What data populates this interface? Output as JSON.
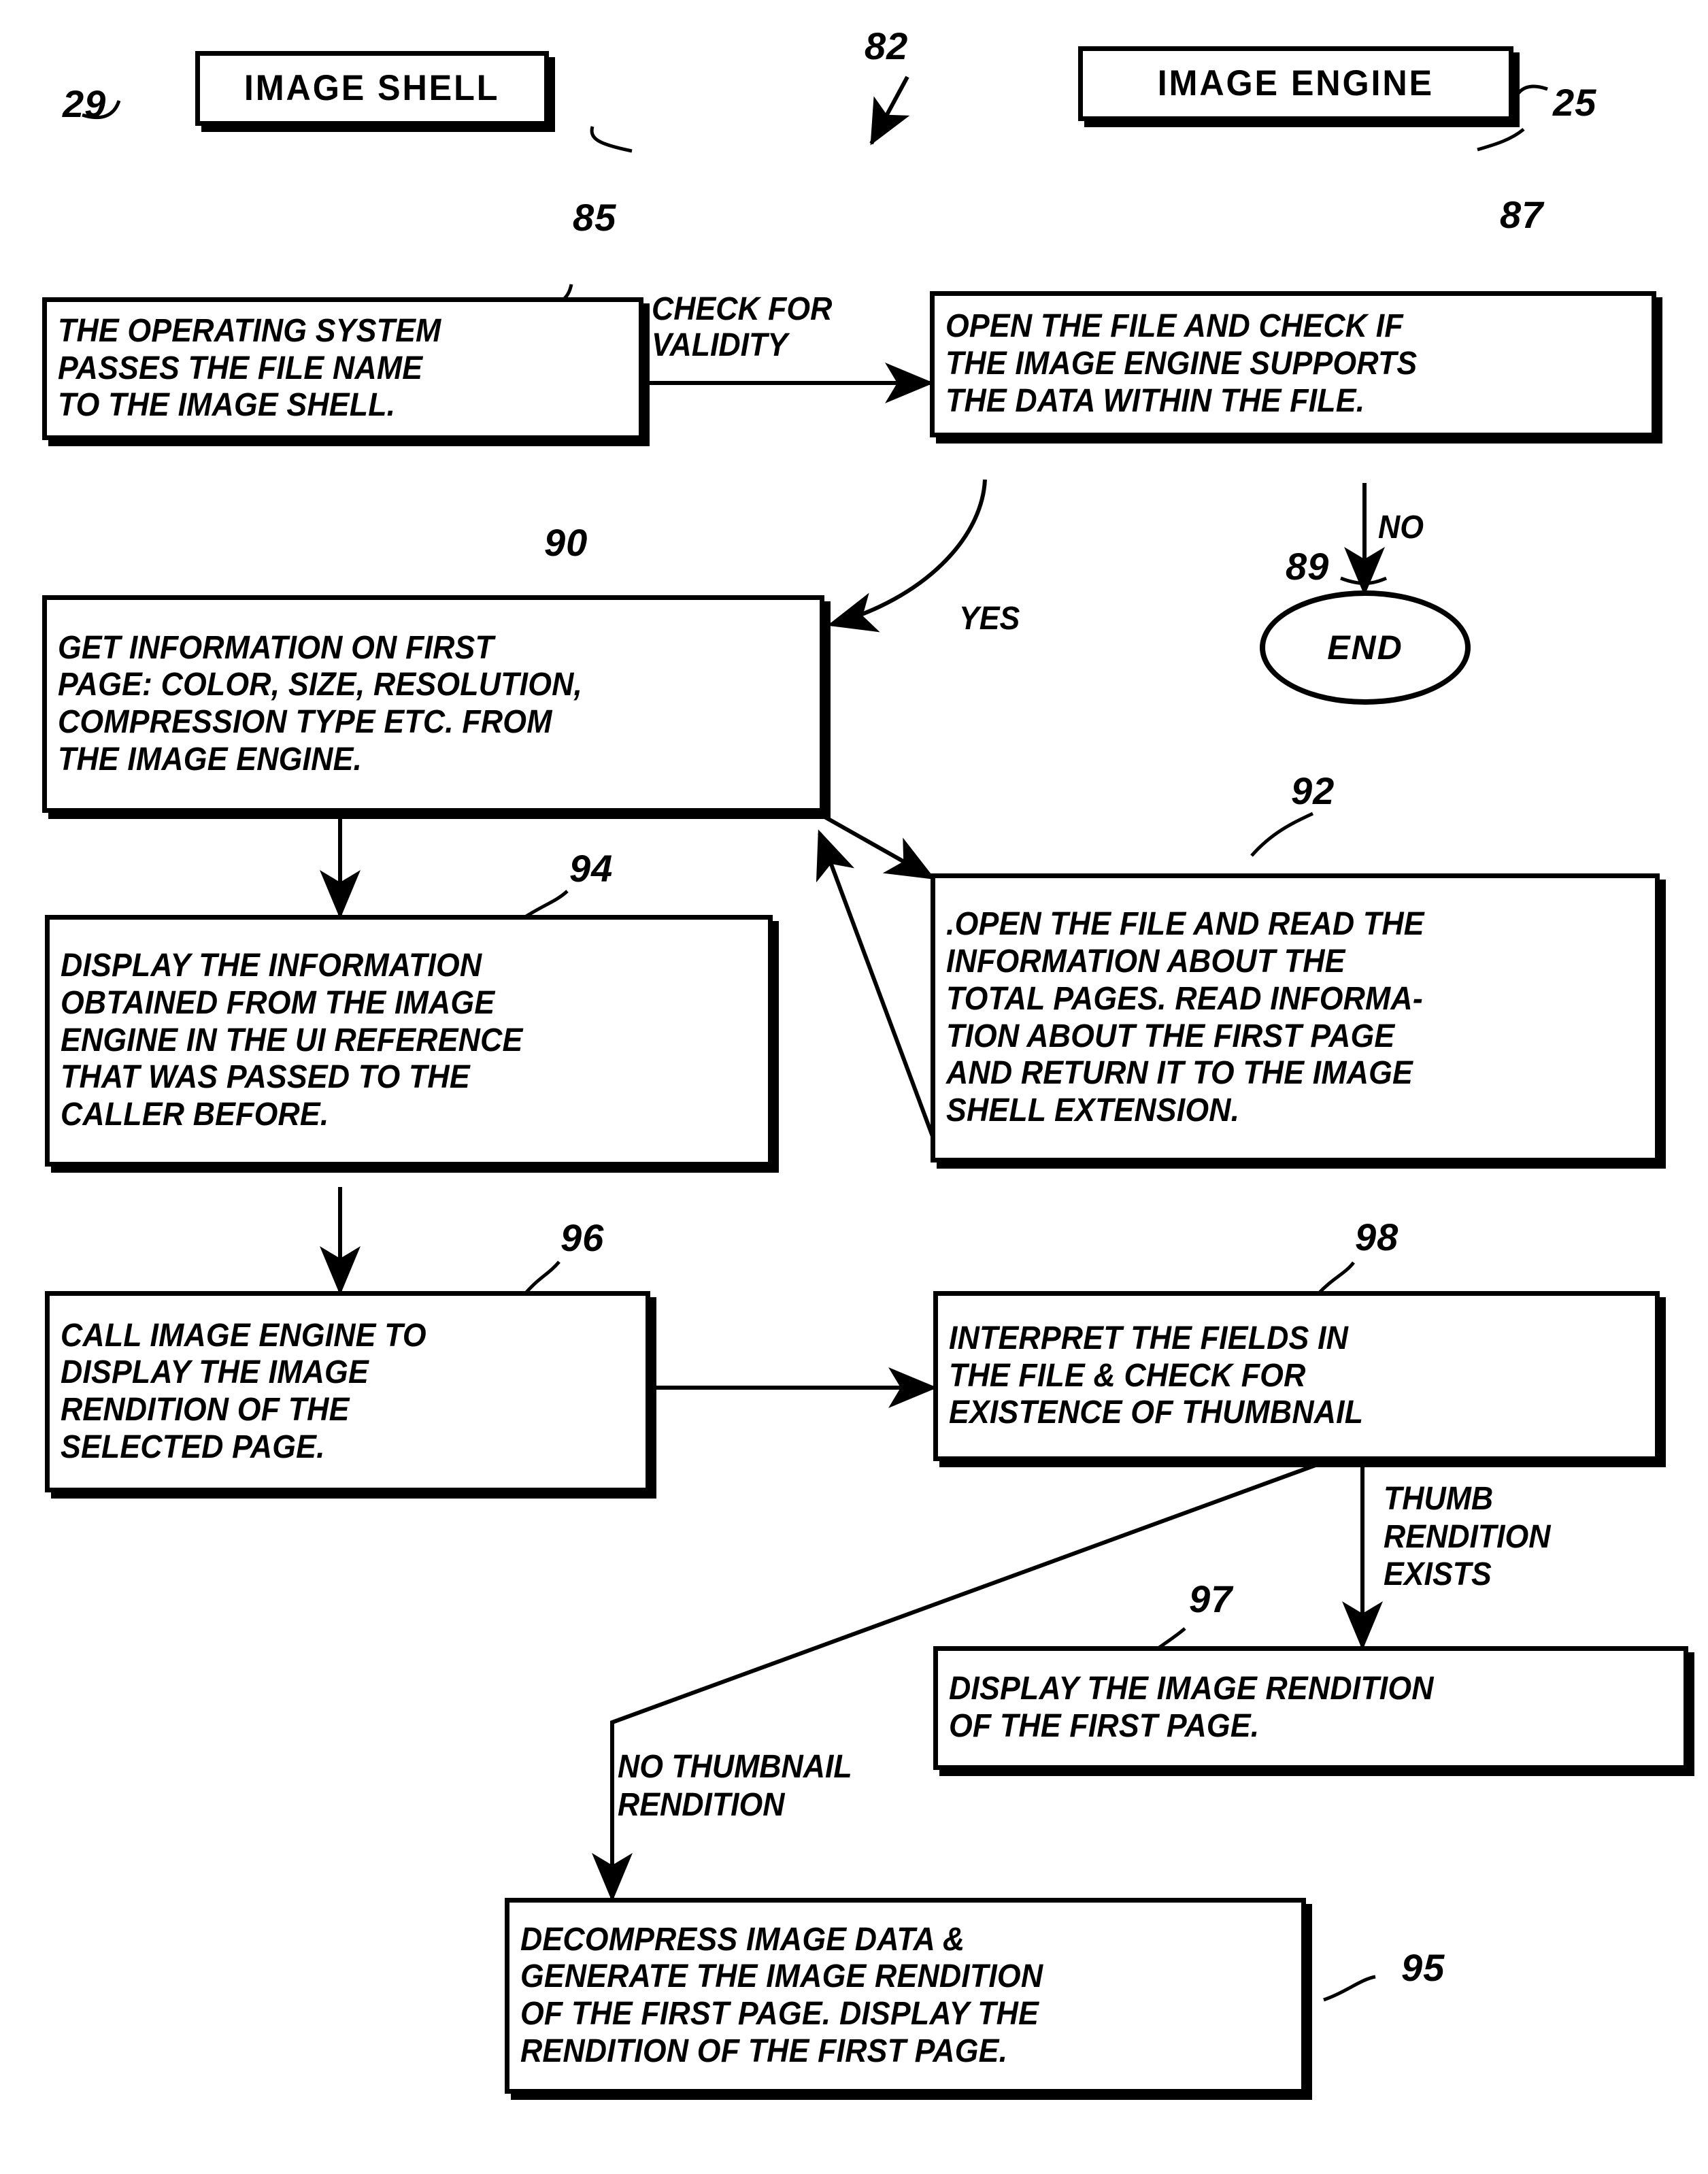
{
  "figure": {
    "type": "patent-flowchart",
    "title_boxes": [
      {
        "ref": "29",
        "label": "IMAGE SHELL"
      },
      {
        "ref": "25",
        "label": "IMAGE ENGINE"
      }
    ],
    "diagram_ref": "82",
    "nodes": [
      {
        "ref": "85",
        "shape": "process",
        "text": "THE OPERATING SYSTEM\nPASSES THE FILE NAME\nTO THE IMAGE SHELL."
      },
      {
        "ref": "87",
        "shape": "process",
        "text": "OPEN THE FILE AND CHECK IF\nTHE IMAGE ENGINE SUPPORTS\nTHE DATA WITHIN THE FILE."
      },
      {
        "ref": "89",
        "shape": "terminator",
        "text": "END"
      },
      {
        "ref": "90",
        "shape": "process",
        "text": "GET INFORMATION ON FIRST\nPAGE: COLOR, SIZE, RESOLUTION,\nCOMPRESSION TYPE ETC. FROM\nTHE IMAGE ENGINE."
      },
      {
        "ref": "92",
        "shape": "process",
        "text": ".OPEN THE FILE AND READ THE\nINFORMATION ABOUT THE\nTOTAL PAGES. READ INFORMA-\nTION ABOUT THE FIRST PAGE\nAND RETURN IT TO THE IMAGE\nSHELL EXTENSION."
      },
      {
        "ref": "94",
        "shape": "process",
        "text": "DISPLAY THE INFORMATION\nOBTAINED FROM THE IMAGE\nENGINE IN THE UI REFERENCE\nTHAT WAS PASSED TO THE\nCALLER BEFORE."
      },
      {
        "ref": "96",
        "shape": "process",
        "text": "CALL IMAGE ENGINE TO\nDISPLAY THE IMAGE\nRENDITION OF THE\nSELECTED PAGE."
      },
      {
        "ref": "98",
        "shape": "process",
        "text": "INTERPRET THE FIELDS IN\nTHE FILE & CHECK FOR\nEXISTENCE OF  THUMBNAIL"
      },
      {
        "ref": "97",
        "shape": "process",
        "text": "DISPLAY THE IMAGE RENDITION\nOF THE FIRST PAGE."
      },
      {
        "ref": "95",
        "shape": "process",
        "text": "DECOMPRESS IMAGE DATA &\nGENERATE THE IMAGE RENDITION\nOF THE FIRST PAGE. DISPLAY THE\nRENDITION OF THE FIRST PAGE."
      }
    ],
    "edge_labels": [
      {
        "id": "check_validity",
        "text": "CHECK FOR\nVALIDITY"
      },
      {
        "id": "no",
        "text": "NO"
      },
      {
        "id": "yes",
        "text": "YES"
      },
      {
        "id": "thumb_exists",
        "text": "THUMB\nRENDITION\nEXISTS"
      },
      {
        "id": "no_thumb",
        "text": "NO THUMBNAIL\nRENDITION"
      }
    ],
    "colors": {
      "ink": "#000000",
      "paper": "#ffffff"
    }
  }
}
